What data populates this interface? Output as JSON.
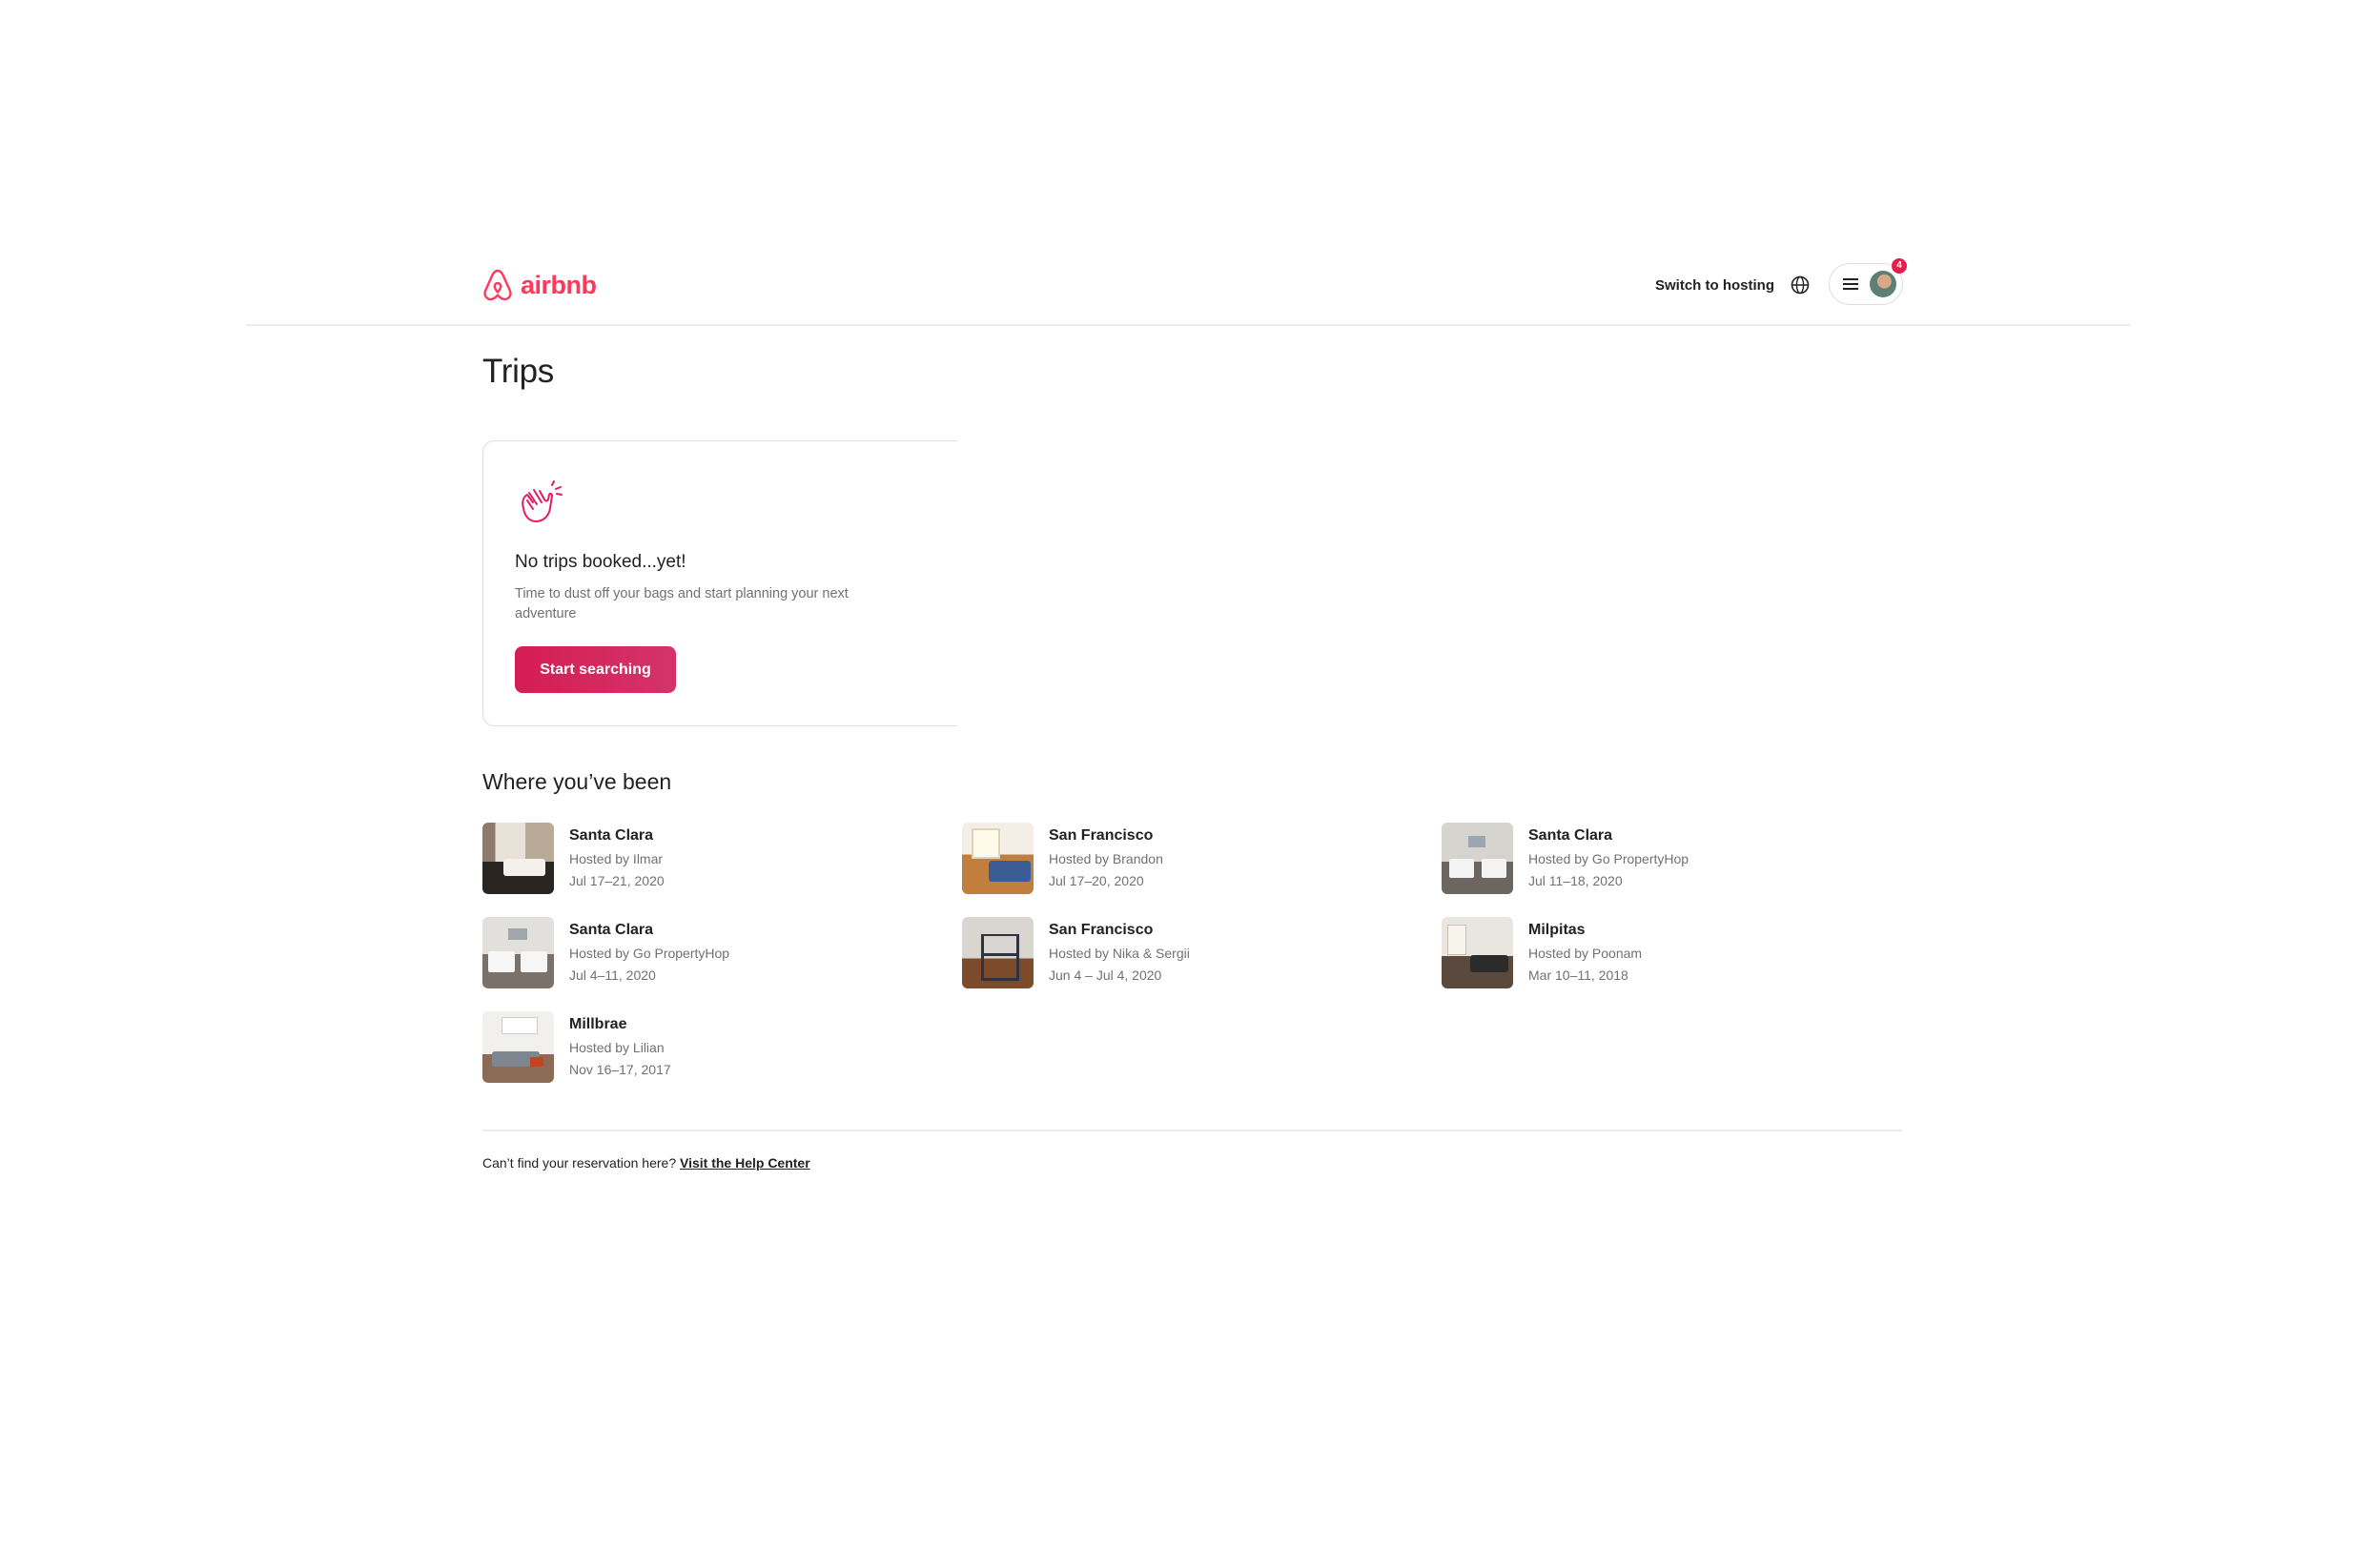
{
  "header": {
    "logo_text": "airbnb",
    "switch_hosting_label": "Switch to hosting",
    "globe_icon": "globe-icon",
    "menu_icon": "hamburger-menu-icon",
    "notification_count": "4",
    "brand_color": "#FF385C"
  },
  "page": {
    "title": "Trips"
  },
  "empty_state": {
    "icon": "waving-hand-icon",
    "title": "No trips booked...yet!",
    "subtitle": "Time to dust off your bags and start planning your next adventure",
    "button_label": "Start searching",
    "button_color": "#D41D54"
  },
  "past_trips": {
    "title": "Where you’ve been",
    "items": [
      {
        "city": "Santa Clara",
        "host": "Hosted by Ilmar",
        "dates": "Jul 17–21, 2020"
      },
      {
        "city": "San Francisco",
        "host": "Hosted by Brandon",
        "dates": "Jul 17–20, 2020"
      },
      {
        "city": "Santa Clara",
        "host": "Hosted by Go PropertyHop",
        "dates": "Jul 11–18, 2020"
      },
      {
        "city": "Santa Clara",
        "host": "Hosted by Go PropertyHop",
        "dates": "Jul 4–11, 2020"
      },
      {
        "city": "San Francisco",
        "host": "Hosted by Nika & Sergii",
        "dates": "Jun 4 – Jul 4, 2020"
      },
      {
        "city": "Milpitas",
        "host": "Hosted by Poonam",
        "dates": "Mar 10–11, 2018"
      },
      {
        "city": "Millbrae",
        "host": "Hosted by Lilian",
        "dates": "Nov 16–17, 2017"
      }
    ]
  },
  "footer": {
    "text": "Can’t find your reservation here?",
    "link_label": "Visit the Help Center"
  }
}
